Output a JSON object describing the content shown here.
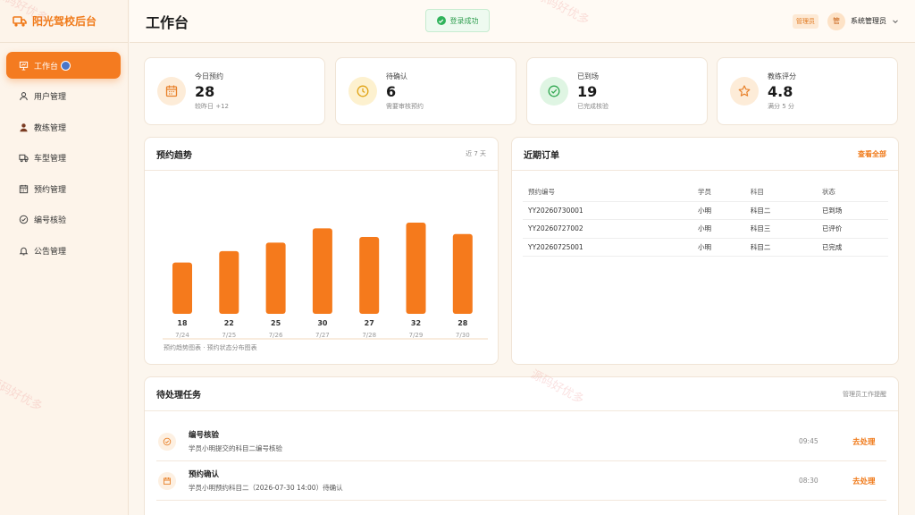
{
  "brand": {
    "name": "阳光驾校后台"
  },
  "sidebar": {
    "items": [
      {
        "label": "工作台",
        "icon": "presentation-icon"
      },
      {
        "label": "用户管理",
        "icon": "user-icon"
      },
      {
        "label": "教练管理",
        "icon": "coach-icon"
      },
      {
        "label": "车型管理",
        "icon": "truck-icon"
      },
      {
        "label": "预约管理",
        "icon": "calendar-icon"
      },
      {
        "label": "编号核验",
        "icon": "check-circle-icon"
      },
      {
        "label": "公告管理",
        "icon": "bell-icon"
      }
    ]
  },
  "header": {
    "title": "工作台",
    "toast": "登录成功",
    "role": "管理员",
    "avatar_char": "管",
    "username": "系统管理员"
  },
  "stats": [
    {
      "label": "今日预约",
      "value": "28",
      "sub": "较昨日 +12",
      "icon": "calendar-icon",
      "color": "#e8812a",
      "bg": "#fdecd8"
    },
    {
      "label": "待确认",
      "value": "6",
      "sub": "需要审核预约",
      "icon": "clock-icon",
      "color": "#e0a417",
      "bg": "#fdf1cf"
    },
    {
      "label": "已到场",
      "value": "19",
      "sub": "已完成核验",
      "icon": "check-circle-icon",
      "color": "#33a852",
      "bg": "#dff5e3"
    },
    {
      "label": "教练评分",
      "value": "4.8",
      "sub": "满分 5 分",
      "icon": "star-icon",
      "color": "#e8812a",
      "bg": "#fdecd8"
    }
  ],
  "trend": {
    "title": "预约趋势",
    "range": "近 7 天",
    "caption": "预约趋势图表 · 预约状态分布图表"
  },
  "chart_data": {
    "type": "bar",
    "categories": [
      "7/24",
      "7/25",
      "7/26",
      "7/27",
      "7/28",
      "7/29",
      "7/30"
    ],
    "values": [
      18,
      22,
      25,
      30,
      27,
      32,
      28
    ],
    "ylim": [
      0,
      32
    ],
    "color": "#f57a1c"
  },
  "orders": {
    "title": "近期订单",
    "link": "查看全部",
    "columns": [
      "预约编号",
      "学员",
      "科目",
      "状态"
    ],
    "rows": [
      [
        "YY20260730001",
        "小明",
        "科目二",
        "已到场"
      ],
      [
        "YY20260727002",
        "小明",
        "科目三",
        "已评价"
      ],
      [
        "YY20260725001",
        "小明",
        "科目二",
        "已完成"
      ]
    ]
  },
  "tasks": {
    "title": "待处理任务",
    "hint": "管理员工作提醒",
    "items": [
      {
        "title": "编号核验",
        "desc": "学员小明提交的科目二编号核验",
        "time": "09:45",
        "action": "去处理",
        "icon": "check-circle-icon"
      },
      {
        "title": "预约确认",
        "desc": "学员小明预约科目二（2026-07-30 14:00）待确认",
        "time": "08:30",
        "action": "去处理",
        "icon": "calendar-icon"
      }
    ]
  },
  "watermark": "源码好优多",
  "colors": {
    "accent": "#f47b20",
    "background": "#fcf6ee",
    "success": "#2fb35a"
  }
}
